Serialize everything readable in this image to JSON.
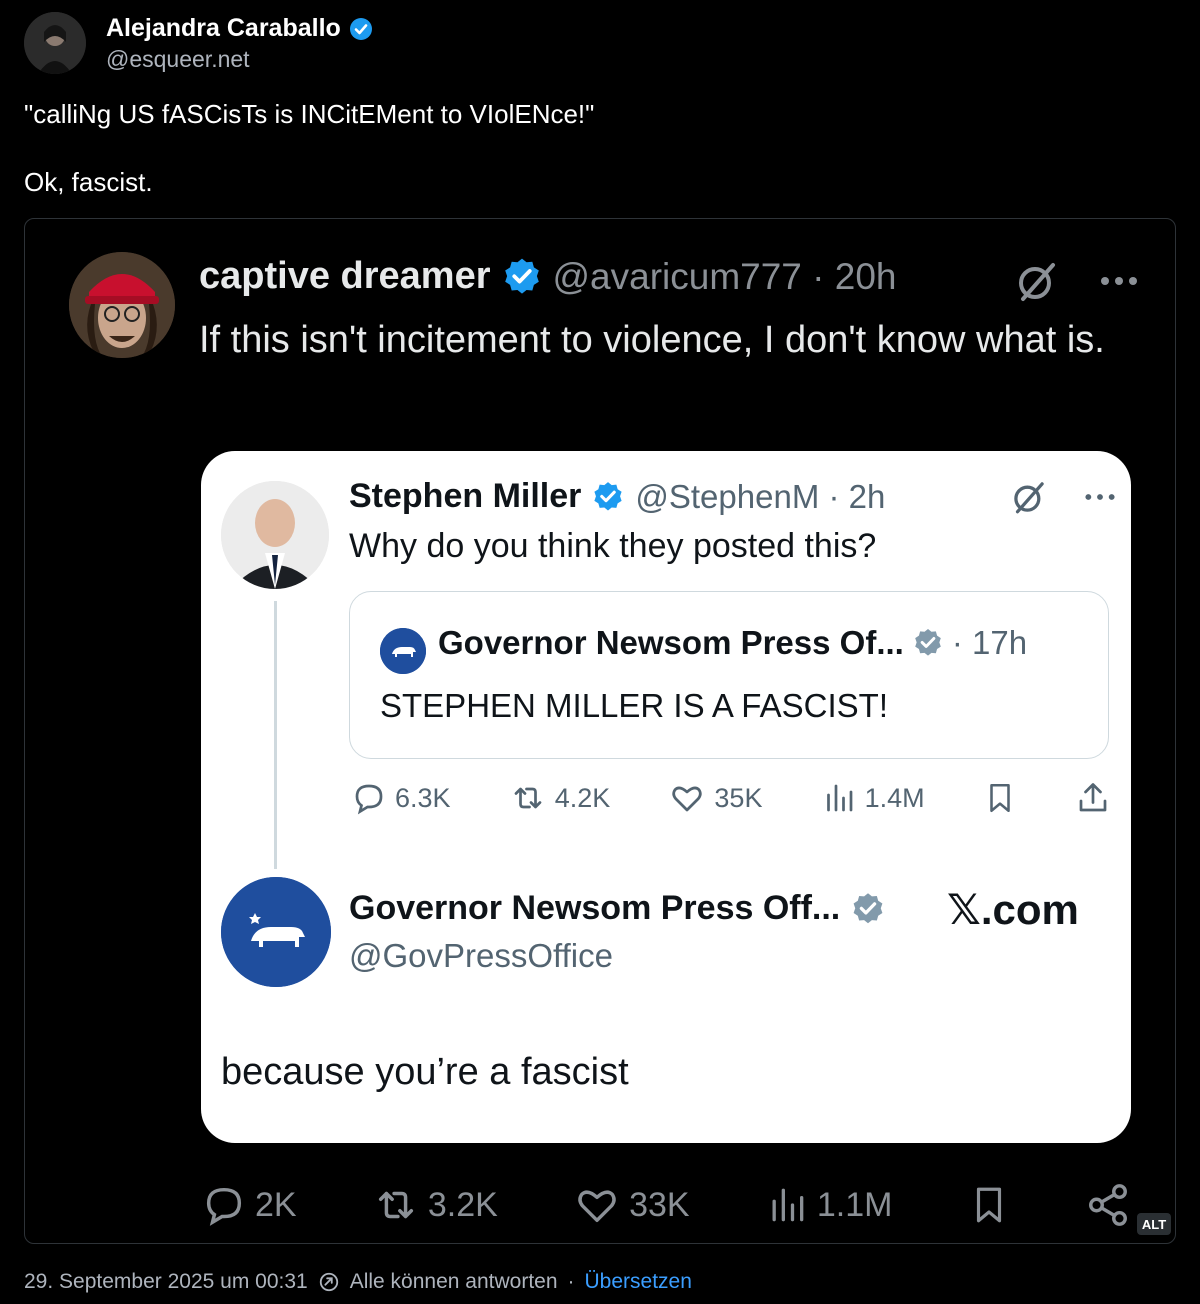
{
  "post": {
    "author_name": "Alejandra Caraballo",
    "author_handle": "@esqueer.net",
    "text_line1": "\"calliNg US fASCisTs is INCitEMent to VIolENce!\"",
    "text_line2": "Ok, fascist.",
    "alt_label": "ALT",
    "accent_color": "#1d9bf0"
  },
  "image": {
    "quote_author": {
      "name": "captive dreamer",
      "handle_time": "@avaricum777 · 20h",
      "text": "If this isn't incitement to violence, I don't know what is."
    },
    "inner_post": {
      "name": "Stephen Miller",
      "handle_time": "@StephenM · 2h",
      "text": "Why do you think they posted this?",
      "quoted": {
        "name": "Governor Newsom Press Of...",
        "time": "· 17h",
        "text": "STEPHEN MILLER IS A FASCIST!"
      },
      "stats": {
        "replies": "6.3K",
        "reposts": "4.2K",
        "likes": "35K",
        "views": "1.4M"
      }
    },
    "reply": {
      "name": "Governor Newsom Press Off...",
      "handle": "@GovPressOffice",
      "brand": "𝕏.com",
      "text": "because you’re a fascist"
    },
    "outer_stats": {
      "replies": "2K",
      "reposts": "3.2K",
      "likes": "33K",
      "views": "1.1M"
    }
  },
  "footer": {
    "timestamp": "29. September 2025 um 00:31",
    "reply_setting": "Alle können antworten",
    "separator": "·",
    "translate": "Übersetzen"
  }
}
